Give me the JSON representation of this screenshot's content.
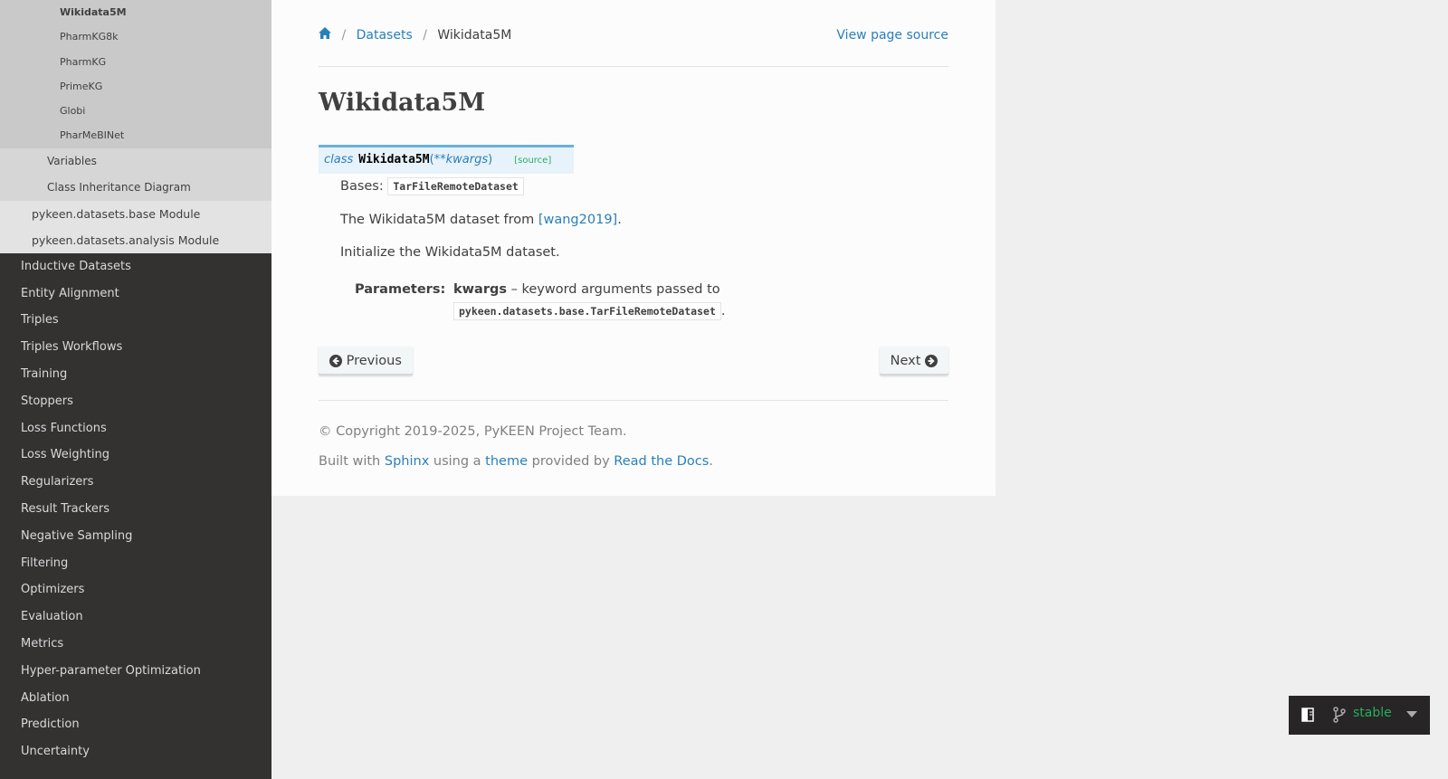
{
  "sidebar": {
    "datasets_list": [
      "Wikidata5M",
      "PharmKG8k",
      "PharmKG",
      "PrimeKG",
      "Globi",
      "PharMeBINet"
    ],
    "sub_sections": [
      "Variables",
      "Class Inheritance Diagram"
    ],
    "modules": [
      "pykeen.datasets.base Module",
      "pykeen.datasets.analysis Module"
    ],
    "toplevel": [
      "Inductive Datasets",
      "Entity Alignment",
      "Triples",
      "Triples Workflows",
      "Training",
      "Stoppers",
      "Loss Functions",
      "Loss Weighting",
      "Regularizers",
      "Result Trackers",
      "Negative Sampling",
      "Filtering",
      "Optimizers",
      "Evaluation",
      "Metrics",
      "Hyper-parameter Optimization",
      "Ablation",
      "Prediction",
      "Uncertainty"
    ]
  },
  "breadcrumb": {
    "datasets": "Datasets",
    "current": "Wikidata5M",
    "sep": "/",
    "view_source": "View page source"
  },
  "page": {
    "title": "Wikidata5M",
    "sig_kw": "class",
    "sig_name": "Wikidata5M",
    "sig_open": "(",
    "sig_param": "**kwargs",
    "sig_close": ")",
    "sig_source": "[source]",
    "bases_label": "Bases:",
    "bases_code": "TarFileRemoteDataset",
    "desc_prefix": "The Wikidata5M dataset from ",
    "desc_link": "[wang2019]",
    "desc_suffix": ".",
    "init_text": "Initialize the Wikidata5M dataset.",
    "params_label": "Parameters:",
    "param_name": "kwargs",
    "param_desc": " – keyword arguments passed to",
    "param_code": "pykeen.datasets.base.TarFileRemoteDataset",
    "param_end": "."
  },
  "nav": {
    "previous": "Previous",
    "next": "Next"
  },
  "footer": {
    "copyright": "© Copyright 2019-2025, PyKEEN Project Team.",
    "built_with": "Built with ",
    "sphinx": "Sphinx",
    "using_a": " using a ",
    "theme": "theme",
    "provided_by": " provided by ",
    "rtd": "Read the Docs",
    "end": "."
  },
  "version_badge": {
    "version": "stable"
  },
  "colors": {
    "sidebar_bg": "#343131",
    "link": "#2980b9",
    "signature_bg": "#e7f2fa",
    "source_green": "#27ae60"
  }
}
